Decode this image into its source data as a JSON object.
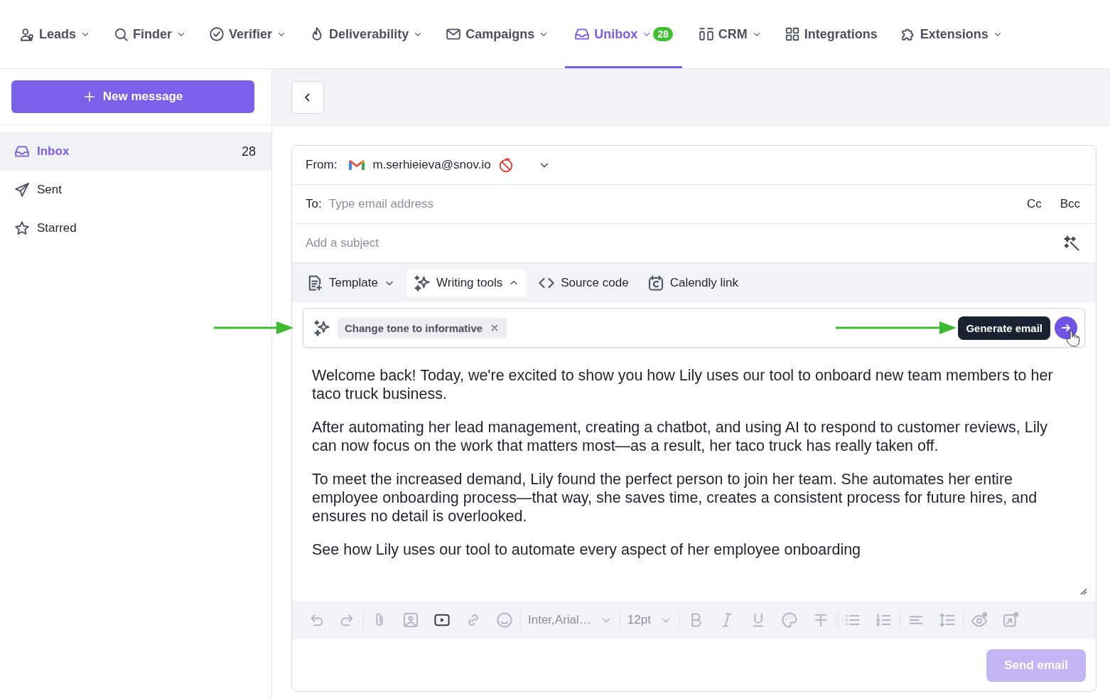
{
  "nav": [
    {
      "label": "Leads",
      "selected": false,
      "dropdown": true
    },
    {
      "label": "Finder",
      "selected": false,
      "dropdown": true
    },
    {
      "label": "Verifier",
      "selected": false,
      "dropdown": true
    },
    {
      "label": "Deliverability",
      "selected": false,
      "dropdown": true
    },
    {
      "label": "Campaigns",
      "selected": false,
      "dropdown": true
    },
    {
      "label": "Unibox",
      "selected": true,
      "dropdown": true,
      "badge": "28"
    },
    {
      "label": "CRM",
      "selected": false,
      "dropdown": true
    },
    {
      "label": "Integrations",
      "selected": false,
      "dropdown": false
    },
    {
      "label": "Extensions",
      "selected": false,
      "dropdown": true
    }
  ],
  "sidebar": {
    "new_message": "New message",
    "folders": [
      {
        "label": "Inbox",
        "selected": true,
        "count": "28"
      },
      {
        "label": "Sent",
        "selected": false
      },
      {
        "label": "Starred",
        "selected": false
      }
    ]
  },
  "compose": {
    "from_label": "From:",
    "from_address": "m.serhieieva@snov.io",
    "to_label": "To:",
    "to_placeholder": "Type email address",
    "cc": "Cc",
    "bcc": "Bcc",
    "subject_placeholder": "Add a subject",
    "tools": [
      {
        "label": "Template",
        "expanded": false,
        "selected": false,
        "dropdown": true
      },
      {
        "label": "Writing tools",
        "expanded": true,
        "selected": true,
        "dropdown": true
      },
      {
        "label": "Source code",
        "selected": false,
        "dropdown": false
      },
      {
        "label": "Calendly link",
        "selected": false,
        "dropdown": false
      }
    ],
    "prompt_chip": "Change tone to informative",
    "generate_tooltip": "Generate email",
    "body": [
      "Welcome back! Today, we're excited to show you how Lily uses our tool to onboard new team members to her taco truck business.",
      "After automating her lead management, creating a chatbot, and using AI to respond to customer reviews, Lily can now focus on the work that matters most—as a result, her taco truck has really taken off.",
      "To meet the increased demand, Lily found the perfect person to join her team. She automates her entire employee onboarding process—that way, she saves time, creates a consistent process for future hires, and ensures no detail is overlooked.",
      "See how Lily uses our tool to automate every aspect of her employee onboarding"
    ],
    "format_toolbar": [
      [
        {
          "kind": "button",
          "disabled": true
        },
        {
          "kind": "button",
          "disabled": true
        }
      ],
      [
        {
          "kind": "button",
          "disabled": true
        },
        {
          "kind": "button",
          "disabled": true
        },
        {
          "kind": "button",
          "disabled": false
        },
        {
          "kind": "button",
          "disabled": true
        },
        {
          "kind": "button",
          "disabled": true
        }
      ],
      [
        {
          "kind": "select",
          "label": "Inter,Arial…",
          "disabled": true
        }
      ],
      [
        {
          "kind": "select",
          "label": "12pt",
          "disabled": true
        }
      ],
      [
        {
          "kind": "button",
          "disabled": true
        },
        {
          "kind": "button",
          "disabled": true
        },
        {
          "kind": "button",
          "disabled": true
        },
        {
          "kind": "button",
          "disabled": true
        },
        {
          "kind": "button",
          "disabled": true
        }
      ],
      [
        {
          "kind": "button",
          "disabled": true
        },
        {
          "kind": "button",
          "disabled": true
        }
      ],
      [
        {
          "kind": "button",
          "disabled": true
        },
        {
          "kind": "button",
          "disabled": true
        }
      ],
      [
        {
          "kind": "button",
          "disabled": true
        },
        {
          "kind": "button",
          "disabled": true
        }
      ]
    ],
    "send": {
      "label": "Send email",
      "disabled": true
    }
  }
}
